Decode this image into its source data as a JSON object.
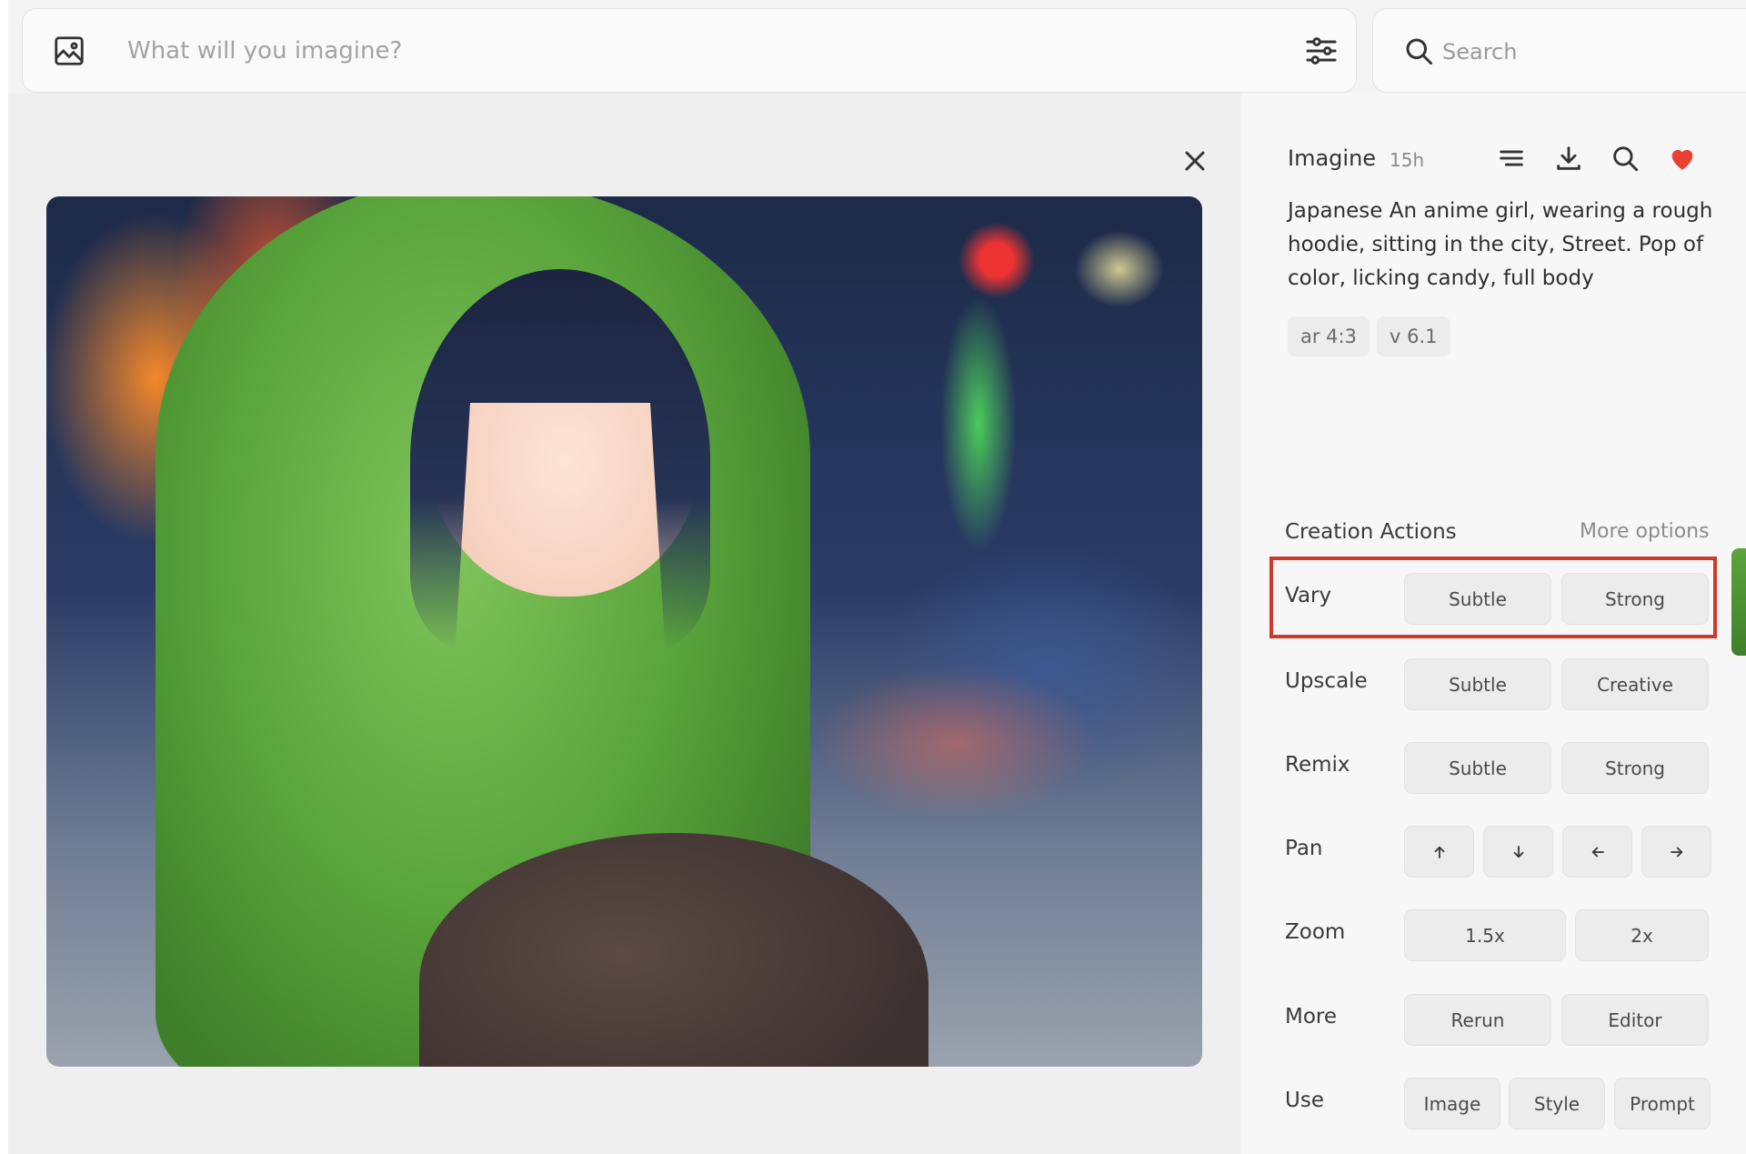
{
  "prompt_bar": {
    "placeholder": "What will you imagine?"
  },
  "search": {
    "placeholder": "Search"
  },
  "detail": {
    "title": "Imagine",
    "time_ago": "15h",
    "prompt": "Japanese An anime girl, wearing a rough hoodie, sitting in the city, Street. Pop of color, licking candy, full body",
    "tags": [
      "ar 4:3",
      "v 6.1"
    ],
    "favorite_color": "#e8412f"
  },
  "creation_actions": {
    "title": "Creation Actions",
    "more_options": "More options",
    "rows": [
      {
        "label": "Vary",
        "buttons": [
          "Subtle",
          "Strong"
        ],
        "highlighted": true
      },
      {
        "label": "Upscale",
        "buttons": [
          "Subtle",
          "Creative"
        ]
      },
      {
        "label": "Remix",
        "buttons": [
          "Subtle",
          "Strong"
        ]
      },
      {
        "label": "Pan",
        "buttons": [
          "arrow-up-icon",
          "arrow-down-icon",
          "arrow-left-icon",
          "arrow-right-icon"
        ]
      },
      {
        "label": "Zoom",
        "buttons": [
          "1.5x",
          "2x"
        ]
      },
      {
        "label": "More",
        "buttons": [
          "Rerun",
          "Editor"
        ]
      },
      {
        "label": "Use",
        "buttons": [
          "Image",
          "Style",
          "Prompt"
        ]
      }
    ]
  },
  "highlight_color": "#cc3a2a"
}
